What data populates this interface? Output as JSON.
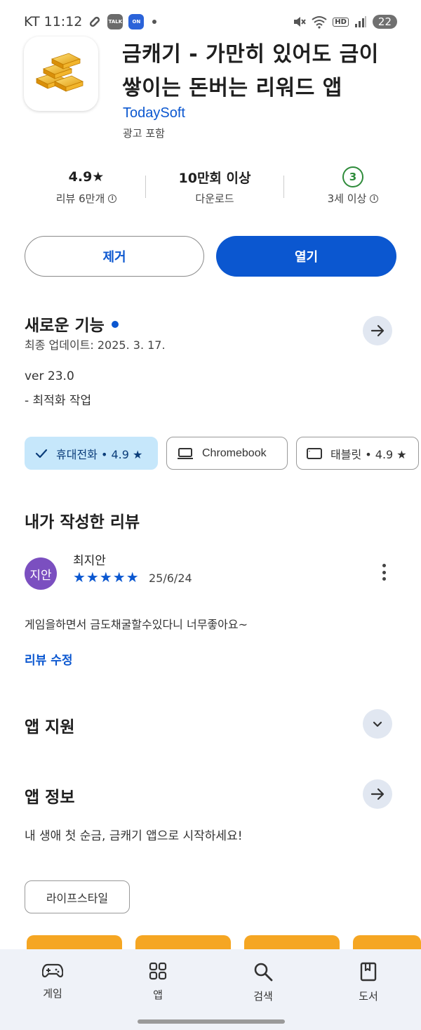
{
  "status_bar": {
    "carrier_time": "KT 11:12",
    "battery": "22",
    "hd": "HD"
  },
  "app": {
    "title_line1": "금캐기 - 가만히 있어도 금이",
    "title_line2": "쌓이는 돈버는 리워드 앱",
    "developer": "TodaySoft",
    "ads_note": "광고 포함",
    "icon": "gold-bars-icon"
  },
  "stats": {
    "rating": "4.9★",
    "reviews": "리뷰 6만개",
    "downloads": "10만회 이상",
    "downloads_label": "다운로드",
    "age_rating": "3",
    "age_label": "3세 이상"
  },
  "buttons": {
    "remove": "제거",
    "open": "열기"
  },
  "whats_new": {
    "title": "새로운 기능",
    "updated": "최종 업데이트: 2025. 3. 17.",
    "version": "ver 23.0",
    "notes": "- 최적화 작업"
  },
  "devices": {
    "phone": "휴대전화 • 4.9 ★",
    "chromebook": "Chromebook",
    "tablet": "태블릿 • 4.9 ★"
  },
  "my_review": {
    "title": "내가 작성한 리뷰",
    "avatar_text": "지안",
    "reviewer": "최지안",
    "stars": "★★★★★",
    "rating": 5,
    "date": "25/6/24",
    "text": "게임을하면서 금도채굴할수있다니 너무좋아요~",
    "edit": "리뷰 수정"
  },
  "app_support": {
    "title": "앱 지원"
  },
  "app_info": {
    "title": "앱 정보",
    "description": "내 생애 첫 순금, 금캐기 앱으로 시작하세요!",
    "tag": "라이프스타일"
  },
  "bottom_nav": {
    "games": "게임",
    "apps": "앱",
    "search": "검색",
    "books": "도서"
  },
  "colors": {
    "accent": "#0b57d0",
    "chip_selected": "#c6e7fb",
    "nav_bg": "#eff2f8",
    "age_green": "#2e8b3a",
    "avatar": "#7b4fc0"
  }
}
